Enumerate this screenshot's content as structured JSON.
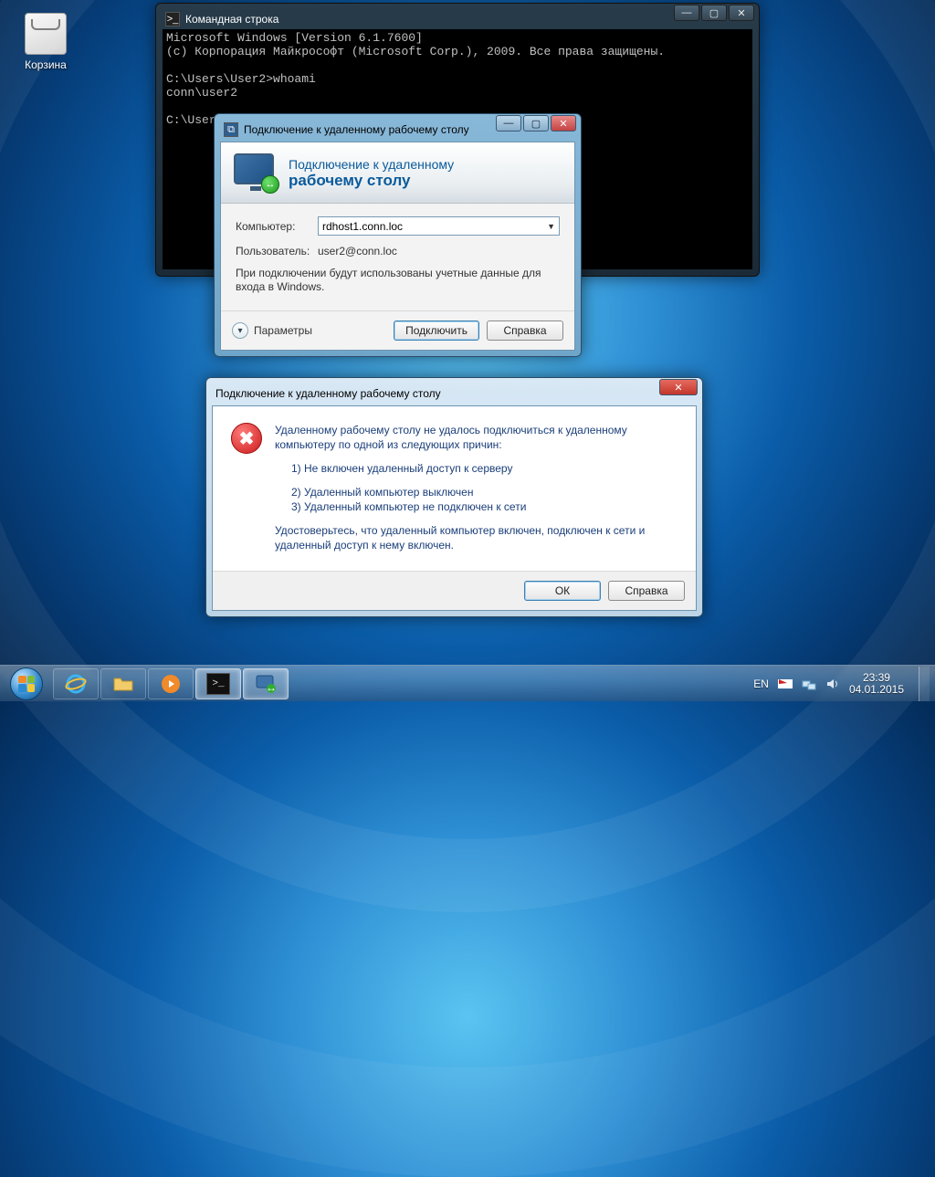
{
  "desktop": {
    "recycle_label": "Корзина"
  },
  "cmd": {
    "title": "Командная строка",
    "lines": "Microsoft Windows [Version 6.1.7600]\n(c) Корпорация Майкрософт (Microsoft Corp.), 2009. Все права защищены.\n\nC:\\Users\\User2>whoami\nconn\\user2\n\nC:\\Users\\User2>"
  },
  "rdp": {
    "title": "Подключение к удаленному рабочему столу",
    "head1": "Подключение к удаленному",
    "head2": "рабочему столу",
    "computer_label": "Компьютер:",
    "computer_value": "rdhost1.conn.loc",
    "user_label": "Пользователь:",
    "user_value": "user2@conn.loc",
    "note": "При подключении будут использованы учетные данные для входа в Windows.",
    "params": "Параметры",
    "connect": "Подключить",
    "help": "Справка"
  },
  "err": {
    "title": "Подключение к удаленному рабочему столу",
    "p1": "Удаленному рабочему столу не удалось подключиться к удаленному компьютеру по одной из следующих причин:",
    "r1": "1) Не включен удаленный доступ к серверу",
    "r2": "2) Удаленный компьютер выключен",
    "r3": "3) Удаленный компьютер не подключен к сети",
    "p2": "Удостоверьтесь, что удаленный компьютер включен, подключен к сети и удаленный доступ к нему включен.",
    "ok": "ОК",
    "help": "Справка"
  },
  "taskbar": {
    "lang": "EN",
    "time": "23:39",
    "date": "04.01.2015"
  }
}
